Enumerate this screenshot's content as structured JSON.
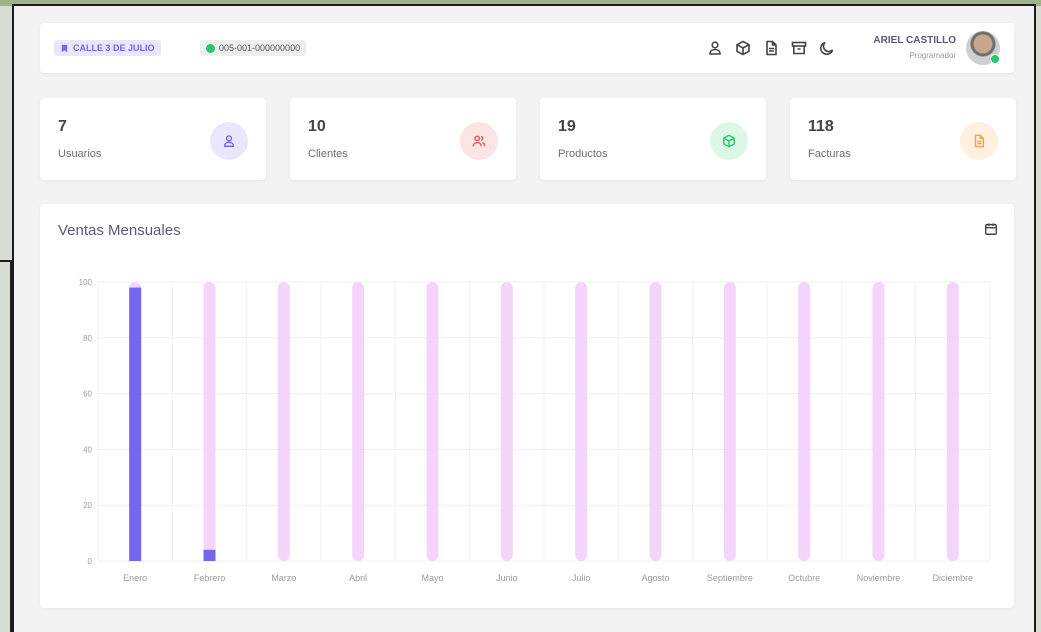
{
  "header": {
    "location_label": "CALLE 3 DE JULIO",
    "invoice_id": "005-001-000000000",
    "nav_icons": [
      "user-icon",
      "box-icon",
      "file-text-icon",
      "archive-icon",
      "moon-icon"
    ],
    "user_name": "ARIEL CASTILLO",
    "user_role": "Programador"
  },
  "stats": [
    {
      "value": "7",
      "label": "Usuarios",
      "icon": "user-icon",
      "bg": "#e9e7fd",
      "color": "#7367f0"
    },
    {
      "value": "10",
      "label": "Clientes",
      "icon": "users-icon",
      "bg": "#fce4e4",
      "color": "#ea5455"
    },
    {
      "value": "19",
      "label": "Productos",
      "icon": "box-icon",
      "bg": "#dcf6e8",
      "color": "#28c76f"
    },
    {
      "value": "118",
      "label": "Facturas",
      "icon": "file-icon",
      "bg": "#fff0e1",
      "color": "#ff9f43"
    }
  ],
  "chart_card": {
    "title": "Ventas Mensuales",
    "icon": "calendar-icon"
  },
  "chart_data": {
    "type": "bar",
    "title": "Ventas Mensuales",
    "categories": [
      "Enero",
      "Febrero",
      "Marzo",
      "Abril",
      "Mayo",
      "Junio",
      "Julio",
      "Agosto",
      "Septiembre",
      "Octubre",
      "Noviembre",
      "Diciembre"
    ],
    "values": [
      98,
      4,
      0,
      0,
      0,
      0,
      0,
      0,
      0,
      0,
      0,
      0
    ],
    "ylim": [
      0,
      100
    ],
    "yticks": [
      0,
      20,
      40,
      60,
      80,
      100
    ],
    "grid": true,
    "bar_color": "#7367f0",
    "track_color": "#f4d4fa"
  }
}
